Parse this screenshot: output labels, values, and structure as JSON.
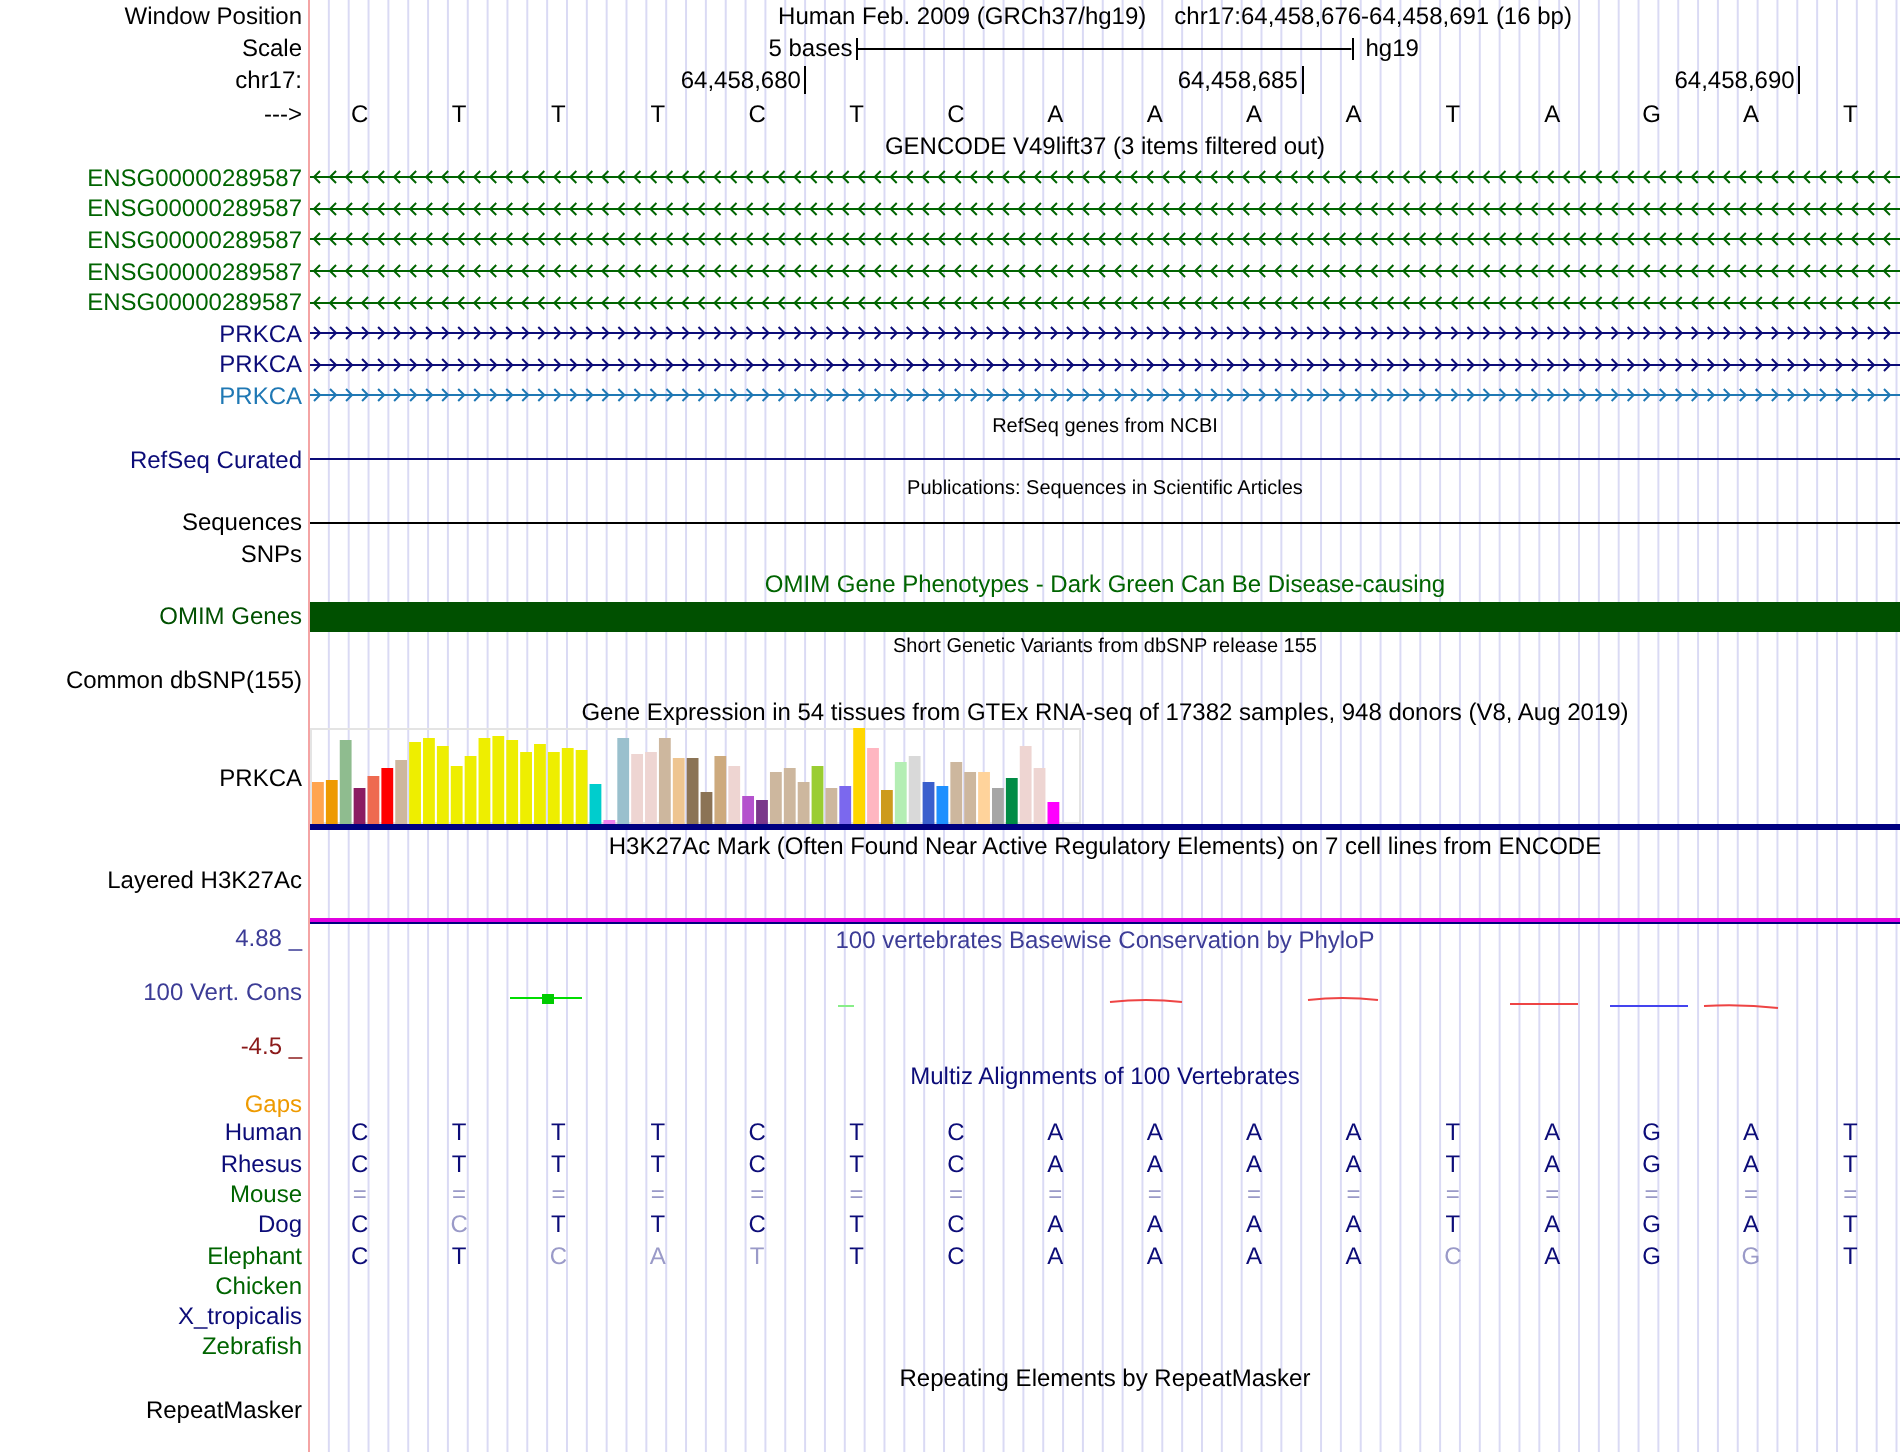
{
  "position": {
    "label": "Window Position",
    "assembly": "Human Feb. 2009 (GRCh37/hg19)",
    "range": "chr17:64,458,676-64,458,691 (16 bp)"
  },
  "scale": {
    "label": "Scale",
    "length": "5 bases",
    "assembly": "hg19"
  },
  "ruler": {
    "label": "chr17:",
    "ticks": [
      "64,458,680",
      "64,458,685",
      "64,458,690"
    ]
  },
  "sequence": {
    "label": "--->",
    "bases": [
      "C",
      "T",
      "T",
      "T",
      "C",
      "T",
      "C",
      "A",
      "A",
      "A",
      "A",
      "T",
      "A",
      "G",
      "A",
      "T"
    ]
  },
  "tracks": [
    {
      "kind": "genes",
      "title": {
        "text": "GENCODE V49lift37 (3 items filtered out)",
        "color": "#000000"
      },
      "items": [
        {
          "label": "ENSG00000289587",
          "color": "#006400",
          "reverse": true
        },
        {
          "label": "ENSG00000289587",
          "color": "#006400",
          "reverse": true
        },
        {
          "label": "ENSG00000289587",
          "color": "#006400",
          "reverse": true
        },
        {
          "label": "ENSG00000289587",
          "color": "#006400",
          "reverse": true
        },
        {
          "label": "ENSG00000289587",
          "color": "#006400",
          "reverse": true
        },
        {
          "label": "PRKCA",
          "color": "#0c0c78",
          "reverse": false
        },
        {
          "label": "PRKCA",
          "color": "#0c0c78",
          "reverse": false
        },
        {
          "label": "PRKCA",
          "color": "#1f78b4",
          "reverse": false
        }
      ]
    },
    {
      "kind": "line",
      "title": {
        "text": "RefSeq genes from NCBI",
        "color": "#000000"
      },
      "label": {
        "text": "RefSeq Curated",
        "color": "#0c0c78"
      }
    },
    {
      "kind": "line",
      "title": {
        "text": "Publications: Sequences in Scientific Articles",
        "color": "#000000"
      },
      "label": {
        "text": "Sequences",
        "color": "#000000"
      }
    },
    {
      "kind": "empty",
      "label": {
        "text": "SNPs",
        "color": "#000000"
      }
    },
    {
      "kind": "block",
      "title": {
        "text": "OMIM Gene Phenotypes - Dark Green Can Be Disease-causing",
        "color": "#006400"
      },
      "label": {
        "text": "OMIM Genes",
        "color": "#005000"
      }
    },
    {
      "kind": "empty",
      "title": {
        "text": "Short Genetic Variants from dbSNP release 155",
        "color": "#000000"
      },
      "label": {
        "text": "Common dbSNP(155)",
        "color": "#000000"
      }
    },
    {
      "kind": "expression",
      "title": {
        "text": "Gene Expression in 54 tissues from GTEx RNA-seq of 17382 samples, 948 donors (V8, Aug 2019)",
        "color": "#000000"
      },
      "label": {
        "text": "PRKCA",
        "color": "#000000"
      }
    },
    {
      "kind": "signal",
      "title": {
        "text": "H3K27Ac Mark (Often Found Near Active Regulatory Elements) on 7 cell lines from ENCODE",
        "color": "#000000"
      },
      "label": {
        "text": "Layered H3K27Ac",
        "color": "#000000"
      }
    },
    {
      "kind": "conservation",
      "title": {
        "text": "100 vertebrates Basewise Conservation by PhyloP",
        "color": "#3c3c96"
      },
      "label": {
        "text": "100 Vert. Cons",
        "color": "#3c3c96"
      },
      "max": {
        "text": "4.88 _",
        "color": "#3c3c96"
      },
      "min": {
        "text": "-4.5 _",
        "color": "#8b1a1a"
      }
    },
    {
      "kind": "alignment",
      "title": {
        "text": "Multiz Alignments of 100 Vertebrates",
        "color": "#0c0c78"
      },
      "gaps": {
        "text": "Gaps",
        "color": "#ee9a00"
      },
      "species": [
        {
          "name": "Human",
          "color": "#0c0c78",
          "bases": [
            {
              "base": "C",
              "faded": false
            },
            {
              "base": "T",
              "faded": false
            },
            {
              "base": "T",
              "faded": false
            },
            {
              "base": "T",
              "faded": false
            },
            {
              "base": "C",
              "faded": false
            },
            {
              "base": "T",
              "faded": false
            },
            {
              "base": "C",
              "faded": false
            },
            {
              "base": "A",
              "faded": false
            },
            {
              "base": "A",
              "faded": false
            },
            {
              "base": "A",
              "faded": false
            },
            {
              "base": "A",
              "faded": false
            },
            {
              "base": "T",
              "faded": false
            },
            {
              "base": "A",
              "faded": false
            },
            {
              "base": "G",
              "faded": false
            },
            {
              "base": "A",
              "faded": false
            },
            {
              "base": "T",
              "faded": false
            }
          ]
        },
        {
          "name": "Rhesus",
          "color": "#0c0c78",
          "bases": [
            {
              "base": "C",
              "faded": false
            },
            {
              "base": "T",
              "faded": false
            },
            {
              "base": "T",
              "faded": false
            },
            {
              "base": "T",
              "faded": false
            },
            {
              "base": "C",
              "faded": false
            },
            {
              "base": "T",
              "faded": false
            },
            {
              "base": "C",
              "faded": false
            },
            {
              "base": "A",
              "faded": false
            },
            {
              "base": "A",
              "faded": false
            },
            {
              "base": "A",
              "faded": false
            },
            {
              "base": "A",
              "faded": false
            },
            {
              "base": "T",
              "faded": false
            },
            {
              "base": "A",
              "faded": false
            },
            {
              "base": "G",
              "faded": false
            },
            {
              "base": "A",
              "faded": false
            },
            {
              "base": "T",
              "faded": false
            }
          ]
        },
        {
          "name": "Mouse",
          "color": "#006400",
          "bases": [
            {
              "base": "=",
              "faded": true
            },
            {
              "base": "=",
              "faded": true
            },
            {
              "base": "=",
              "faded": true
            },
            {
              "base": "=",
              "faded": true
            },
            {
              "base": "=",
              "faded": true
            },
            {
              "base": "=",
              "faded": true
            },
            {
              "base": "=",
              "faded": true
            },
            {
              "base": "=",
              "faded": true
            },
            {
              "base": "=",
              "faded": true
            },
            {
              "base": "=",
              "faded": true
            },
            {
              "base": "=",
              "faded": true
            },
            {
              "base": "=",
              "faded": true
            },
            {
              "base": "=",
              "faded": true
            },
            {
              "base": "=",
              "faded": true
            },
            {
              "base": "=",
              "faded": true
            },
            {
              "base": "=",
              "faded": true
            }
          ]
        },
        {
          "name": "Dog",
          "color": "#0c0c78",
          "bases": [
            {
              "base": "C",
              "faded": false
            },
            {
              "base": "C",
              "faded": true
            },
            {
              "base": "T",
              "faded": false
            },
            {
              "base": "T",
              "faded": false
            },
            {
              "base": "C",
              "faded": false
            },
            {
              "base": "T",
              "faded": false
            },
            {
              "base": "C",
              "faded": false
            },
            {
              "base": "A",
              "faded": false
            },
            {
              "base": "A",
              "faded": false
            },
            {
              "base": "A",
              "faded": false
            },
            {
              "base": "A",
              "faded": false
            },
            {
              "base": "T",
              "faded": false
            },
            {
              "base": "A",
              "faded": false
            },
            {
              "base": "G",
              "faded": false
            },
            {
              "base": "A",
              "faded": false
            },
            {
              "base": "T",
              "faded": false
            }
          ]
        },
        {
          "name": "Elephant",
          "color": "#006400",
          "bases": [
            {
              "base": "C",
              "faded": false
            },
            {
              "base": "T",
              "faded": false
            },
            {
              "base": "C",
              "faded": true
            },
            {
              "base": "A",
              "faded": true
            },
            {
              "base": "T",
              "faded": true
            },
            {
              "base": "T",
              "faded": false
            },
            {
              "base": "C",
              "faded": false
            },
            {
              "base": "A",
              "faded": false
            },
            {
              "base": "A",
              "faded": false
            },
            {
              "base": "A",
              "faded": false
            },
            {
              "base": "A",
              "faded": false
            },
            {
              "base": "C",
              "faded": true
            },
            {
              "base": "A",
              "faded": false
            },
            {
              "base": "G",
              "faded": false
            },
            {
              "base": "G",
              "faded": true
            },
            {
              "base": "T",
              "faded": false
            }
          ]
        },
        {
          "name": "Chicken",
          "color": "#006400"
        },
        {
          "name": "X_tropicalis",
          "color": "#0c0c78"
        },
        {
          "name": "Zebrafish",
          "color": "#006400"
        }
      ]
    },
    {
      "kind": "empty",
      "title": {
        "text": "Repeating Elements by RepeatMasker",
        "color": "#000000"
      },
      "label": {
        "text": "RepeatMasker",
        "color": "#000000"
      }
    }
  ]
}
